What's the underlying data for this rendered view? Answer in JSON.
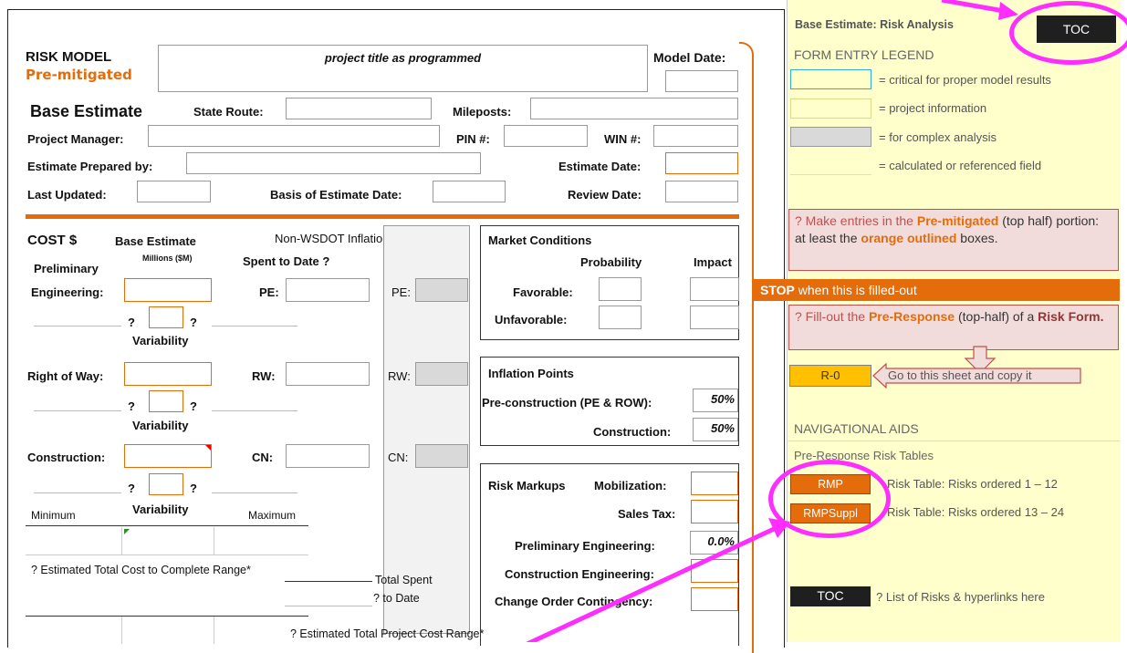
{
  "form": {
    "risk_model": "RISK MODEL",
    "pre_mitigated": "Pre-mitigated",
    "project_title_placeholder": "project title as programmed",
    "model_date": "Model Date:",
    "base_estimate": "Base Estimate",
    "state_route": "State Route:",
    "mileposts": "Mileposts:",
    "project_manager": "Project Manager:",
    "pin": "PIN #:",
    "win": "WIN #:",
    "estimate_prepared_by": "Estimate Prepared by:",
    "estimate_date": "Estimate Date:",
    "last_updated": "Last Updated:",
    "basis_of_estimate_date": "Basis of Estimate Date:",
    "review_date": "Review Date:"
  },
  "cost": {
    "cost_heading": "COST $",
    "base_estimate": "Base Estimate",
    "millions": "Millions ($M)",
    "non_wsdot": "Non-WSDOT Inflation Rates",
    "q": "?",
    "spent_to_date": "Spent to Date ?",
    "preliminary": "Preliminary",
    "engineering": "Engineering:",
    "pe": "PE:",
    "variability": "Variability",
    "right_of_way": "Right of Way:",
    "rw": "RW:",
    "construction": "Construction:",
    "cn": "CN:",
    "minimum": "Minimum",
    "maximum": "Maximum",
    "est_total_complete": "?  Estimated Total Cost to Complete Range*",
    "total_spent": "Total Spent",
    "to_date": "? to Date",
    "est_total_project": "? Estimated Total Project Cost Range*"
  },
  "market": {
    "heading": "Market Conditions",
    "probability": "Probability",
    "impact": "Impact",
    "favorable": "Favorable:",
    "unfavorable": "Unfavorable:"
  },
  "inflation": {
    "heading": "Inflation Points",
    "preconstruction": "Pre-construction (PE & ROW):",
    "preconstruction_value": "50%",
    "construction": "Construction:",
    "construction_value": "50%"
  },
  "markups": {
    "heading": "Risk Markups",
    "mobilization": "Mobilization:",
    "sales_tax": "Sales Tax:",
    "prelim_eng": "Preliminary Engineering:",
    "prelim_eng_value": "0.0%",
    "construction_eng": "Construction Engineering:",
    "change_order": "Change Order Contingency:"
  },
  "sidebar": {
    "title": "Base Estimate: Risk Analysis",
    "toc": "TOC",
    "legend_heading": "FORM ENTRY LEGEND",
    "legend": [
      {
        "text": "= critical for proper model results",
        "color": "#ffffcc",
        "border": "#31b0c8"
      },
      {
        "text": "= project information",
        "color": "#ffffcc",
        "border": "#d9d98c"
      },
      {
        "text": "= for complex analysis",
        "color": "#d9d9d9",
        "border": "#9a9a9a"
      },
      {
        "text": "= calculated or referenced field",
        "color": "#ffffcc",
        "border": "#ffffcc"
      }
    ],
    "note1_prefix": "?    Make entries in the ",
    "note1_bold1": "Pre-mitigated",
    "note1_mid": " (top half) portion: at least the ",
    "note1_bold2": "orange outlined",
    "note1_suffix": " boxes.",
    "stop": "STOP",
    "stop_text": " when this is filled-out",
    "note2_prefix": "?    Fill-out the ",
    "note2_bold1": "Pre-Response",
    "note2_mid": " (top-half) of a ",
    "note2_bold2": "Risk Form.",
    "r0": "R-0",
    "go_to_sheet": "Go to this sheet and copy it",
    "nav_heading": "NAVIGATIONAL AIDS",
    "pre_response_tables": "Pre-Response Risk Tables",
    "rmp": "RMP",
    "rmp_text": "Risk Table:  Risks ordered 1 – 12",
    "rmpsuppl": "RMPSuppl",
    "rmpsuppl_text": "Risk Table:  Risks ordered 13 – 24",
    "toc2": "TOC",
    "toc2_text": "? List of Risks & hyperlinks here"
  },
  "colors": {
    "orange": "#e46c0a",
    "sidebar_bg": "#ffffcc",
    "magenta": "#ff2dff",
    "note_bg": "#f2dcdb",
    "r0_fill": "#ffc000"
  }
}
